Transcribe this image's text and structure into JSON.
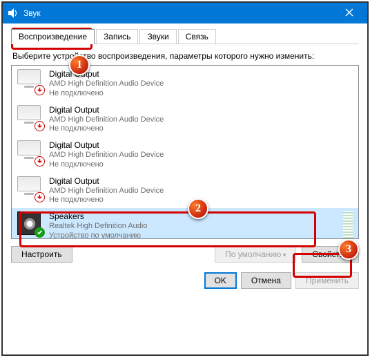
{
  "window": {
    "title": "Звук"
  },
  "tabs": {
    "playback": "Воспроизведение",
    "recording": "Запись",
    "sounds": "Звуки",
    "comm": "Связь"
  },
  "instruction": "Выберите устройство воспроизведения, параметры которого нужно изменить:",
  "devices": [
    {
      "name": "Digital Output",
      "desc": "AMD High Definition Audio Device",
      "status": "Не подключено",
      "kind": "monitor",
      "badge": "down"
    },
    {
      "name": "Digital Output",
      "desc": "AMD High Definition Audio Device",
      "status": "Не подключено",
      "kind": "monitor",
      "badge": "down"
    },
    {
      "name": "Digital Output",
      "desc": "AMD High Definition Audio Device",
      "status": "Не подключено",
      "kind": "monitor",
      "badge": "down"
    },
    {
      "name": "Digital Output",
      "desc": "AMD High Definition Audio Device",
      "status": "Не подключено",
      "kind": "monitor",
      "badge": "down"
    },
    {
      "name": "Speakers",
      "desc": "Realtek High Definition Audio",
      "status": "Устройство по умолчанию",
      "kind": "speaker",
      "badge": "ok",
      "selected": true
    }
  ],
  "buttons": {
    "configure": "Настроить",
    "default": "По умолчанию",
    "properties": "Свойства",
    "ok": "OK",
    "cancel": "Отмена",
    "apply": "Применить"
  },
  "annotations": {
    "n1": "1",
    "n2": "2",
    "n3": "3"
  }
}
